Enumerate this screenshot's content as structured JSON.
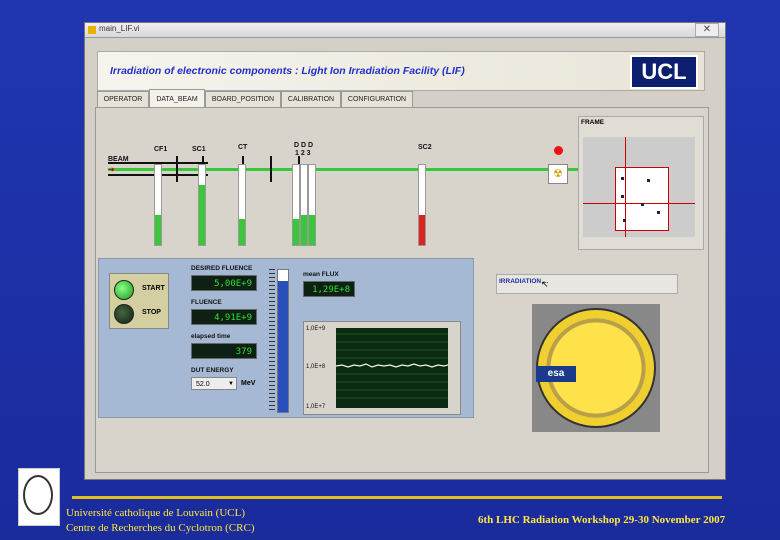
{
  "window": {
    "title": "main_LIF.vi",
    "close": "✕"
  },
  "banner": {
    "title": "Irradiation of electronic components : Light Ion Irradiation Facility (LIF)",
    "logo": "UCL"
  },
  "tabs": [
    "OPERATOR",
    "DATA_BEAM",
    "BOARD_POSITION",
    "CALIBRATION",
    "CONFIGURATION"
  ],
  "active_tab": "DATA_BEAM",
  "beam_labels": {
    "beam": "BEAM",
    "cf1": "CF1",
    "sc1": "SC1",
    "ct": "CT",
    "d": "D D D",
    "nums": "1 2 3",
    "sc2": "SC2",
    "frame": "FRAME"
  },
  "controls": {
    "start": "START",
    "stop": "STOP",
    "desired_fluence_label": "DESIRED FLUENCE",
    "desired_fluence": "5,00E+9",
    "fluence_label": "FLUENCE",
    "fluence": "4,91E+9",
    "elapsed_label": "elapsed time",
    "elapsed": "379",
    "dut_label": "DUT ENERGY",
    "dut_value": "52.0",
    "dut_unit": "MeV",
    "flux_label": "mean FLUX",
    "flux": "1,29E+8",
    "flux_axis": [
      "1,0E+9",
      "1,0E+8",
      "1,0E+7"
    ]
  },
  "irradiation_label": "IRRADIATION ...",
  "logo_text": "esa",
  "footer": {
    "left_line1": "Université catholique de Louvain (UCL)",
    "left_line2": "Centre de Recherches du Cyclotron (CRC)",
    "right": "6th LHC Radiation Workshop 29-30 November 2007"
  },
  "colors": {
    "beam": "#36c836",
    "accent": "#2030c8",
    "footer_text": "#ffe640"
  }
}
